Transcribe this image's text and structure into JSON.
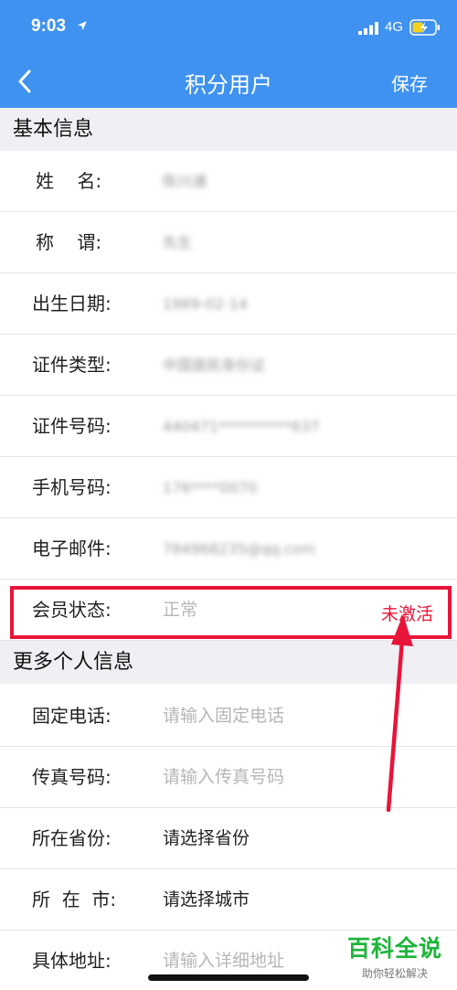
{
  "status_bar": {
    "time": "9:03",
    "network": "4G",
    "icons": [
      "location-arrow-icon",
      "signal-icon",
      "battery-icon"
    ]
  },
  "nav": {
    "title": "积分用户",
    "save": "保存",
    "back_icon": "chevron-left-icon"
  },
  "sections": {
    "basic": "基本信息",
    "more": "更多个人信息"
  },
  "basic_fields": [
    {
      "label": "姓    名:",
      "value": "陈兴通"
    },
    {
      "label": "称    谓:",
      "value": "先生"
    },
    {
      "label": "出生日期:",
      "value": "1989-02-14"
    },
    {
      "label": "证件类型:",
      "value": "中国居民身份证"
    },
    {
      "label": "证件号码:",
      "value": "440471**********637"
    },
    {
      "label": "手机号码:",
      "value": "176****0070"
    },
    {
      "label": "电子邮件:",
      "value": "784968235@qq.com"
    },
    {
      "label": "会员状态:",
      "value": "正常"
    }
  ],
  "member_status_annotation": "未激活",
  "more_fields": [
    {
      "label": "固定电话:",
      "placeholder": "请输入固定电话"
    },
    {
      "label": "传真号码:",
      "placeholder": "请输入传真号码"
    },
    {
      "label": "所在省份:",
      "value": "请选择省份"
    },
    {
      "label": "所  在  市:",
      "value": "请选择城市"
    },
    {
      "label": "具体地址:",
      "placeholder": "请输入详细地址"
    }
  ],
  "watermark": {
    "title": "百科全说",
    "subtitle": "助你轻松解决"
  },
  "colors": {
    "header_blue": "#3f92f0",
    "highlight_red": "#e8143a",
    "section_bg": "#efeff4",
    "watermark_green": "#1eb53a"
  }
}
